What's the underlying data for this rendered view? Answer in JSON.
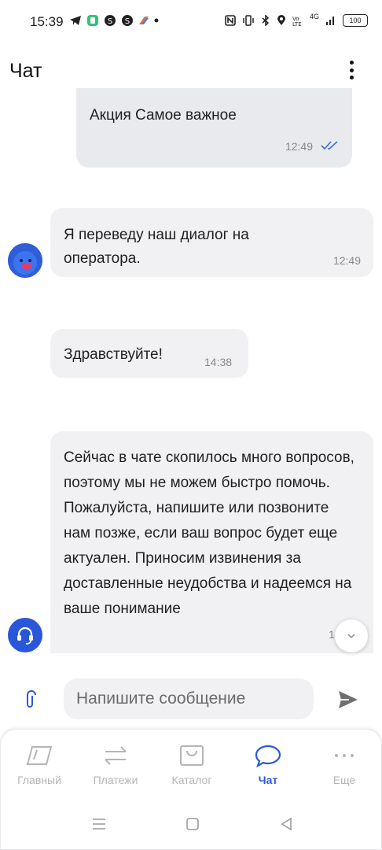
{
  "status_bar": {
    "time": "15:39",
    "network": "4G",
    "battery": "100"
  },
  "header": {
    "title": "Чат"
  },
  "messages": [
    {
      "text": "Акция Самое важное",
      "time": "12:49",
      "from": "user",
      "status": "read"
    },
    {
      "text": "Я переведу наш диалог на оператора.",
      "time": "12:49",
      "from": "bot"
    },
    {
      "text": "Здравствуйте!",
      "time": "14:38",
      "from": "operator"
    },
    {
      "text": "Сейчас в чате скопилось много вопросов, поэтому мы не можем быстро помочь. Пожалуйста, напишите или позвоните нам позже, если ваш вопрос будет еще актуален. Приносим извинения за доставленные неудобства и надеемся на ваше понимание",
      "time": "1",
      "from": "operator"
    }
  ],
  "composer": {
    "placeholder": "Напишите сообщение"
  },
  "bottom_nav": {
    "items": [
      {
        "label": "Главный",
        "icon": "card-icon",
        "active": false
      },
      {
        "label": "Платежи",
        "icon": "transfer-arrows-icon",
        "active": false
      },
      {
        "label": "Каталог",
        "icon": "shopping-bag-icon",
        "active": false
      },
      {
        "label": "Чат",
        "icon": "chat-bubble-icon",
        "active": true
      },
      {
        "label": "Еще",
        "icon": "more-dots-icon",
        "active": false
      }
    ]
  },
  "colors": {
    "accent": "#2b59d8",
    "bubble": "#f1f1f3",
    "inactive": "#b5b5b8"
  }
}
